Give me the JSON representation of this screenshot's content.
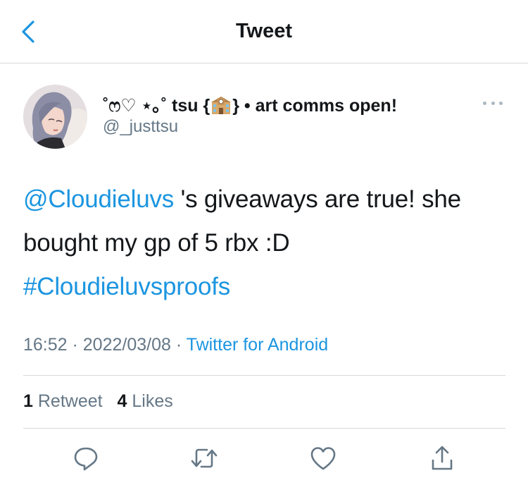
{
  "header": {
    "title": "Tweet",
    "back_icon": "chevron-left-icon",
    "accent_color": "#1b95e0"
  },
  "author": {
    "name_prefix": "˚ෆ♡ ⋆｡˚ tsu {",
    "name_emoji": "school-building-emoji",
    "name_suffix": "} • art comms open!",
    "handle": "@_justtsu",
    "more_icon": "more-horizontal-icon"
  },
  "tweet": {
    "mention": "@Cloudieluvs",
    "text_part1": " 's giveaways are true! she bought my gp of 5 rbx :D",
    "hashtag": "#Cloudieluvsproofs"
  },
  "meta": {
    "time": "16:52",
    "separator1": " · ",
    "date": "2022/03/08",
    "separator2": " · ",
    "source": "Twitter for Android"
  },
  "stats": {
    "retweets_count": "1",
    "retweets_label": "Retweet",
    "likes_count": "4",
    "likes_label": "Likes"
  },
  "actions": {
    "reply_icon": "reply-icon",
    "retweet_icon": "retweet-icon",
    "like_icon": "heart-icon",
    "share_icon": "share-icon"
  }
}
